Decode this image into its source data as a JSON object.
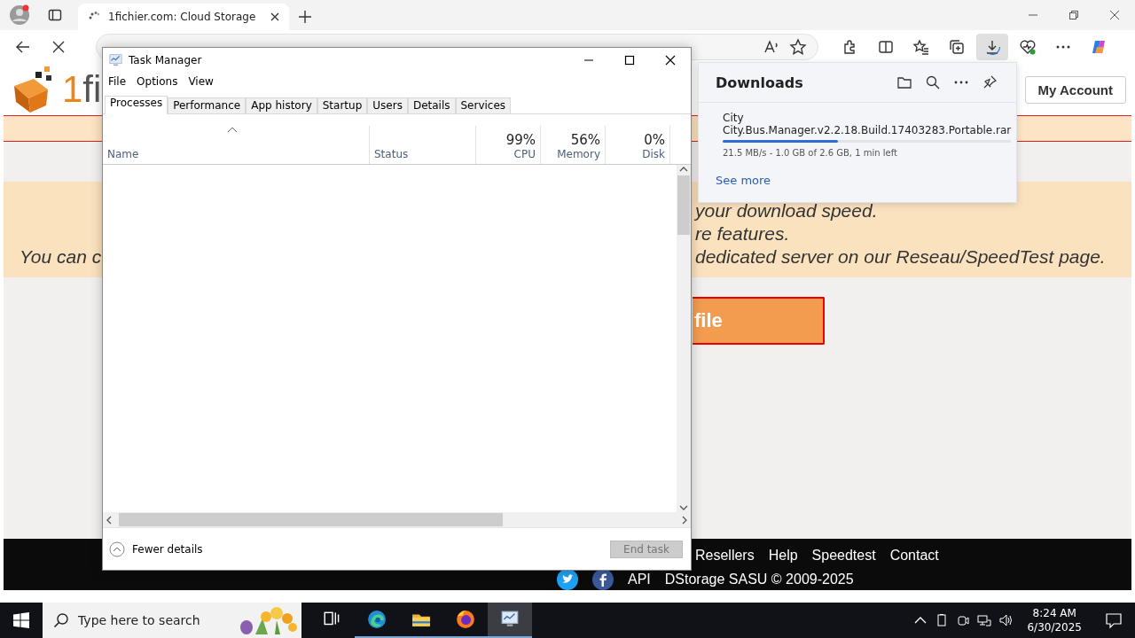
{
  "browser": {
    "tabs": [
      {
        "title": "1fichier.com: Cloud Storage",
        "selected": true,
        "loading": true
      }
    ],
    "toolbar": {
      "loading": true,
      "downloads_open": true
    }
  },
  "site": {
    "logo": {
      "accent": "1",
      "rest": "fi"
    },
    "account_button": "My Account",
    "notice_lines": [
      {
        "right": "your download speed."
      },
      {
        "right": "re features."
      },
      {
        "left": "You can c",
        "right": "dedicated server on our Reseau/SpeedTest page."
      }
    ],
    "download_button": "file",
    "footer": {
      "links": [
        "Resellers",
        "Help",
        "Speedtest",
        "Contact"
      ],
      "api": "API",
      "copyright": "DStorage SASU © 2009-2025"
    }
  },
  "task_manager": {
    "title": "Task Manager",
    "menu": [
      "File",
      "Options",
      "View"
    ],
    "tabs": [
      {
        "label": "Processes",
        "selected": true
      },
      {
        "label": "Performance",
        "selected": false
      },
      {
        "label": "App history",
        "selected": false
      },
      {
        "label": "Startup",
        "selected": false
      },
      {
        "label": "Users",
        "selected": false
      },
      {
        "label": "Details",
        "selected": false
      },
      {
        "label": "Services",
        "selected": false
      }
    ],
    "columns": [
      {
        "label": "Name",
        "kind": "text"
      },
      {
        "label": "Status",
        "kind": "text"
      },
      {
        "label": "CPU",
        "reading": "99%",
        "kind": "metric"
      },
      {
        "label": "Memory",
        "reading": "56%",
        "kind": "metric"
      },
      {
        "label": "Disk",
        "reading": "0%",
        "kind": "metric"
      }
    ],
    "fewer_details": "Fewer details",
    "end_task": {
      "label": "End task",
      "disabled": true
    }
  },
  "downloads": {
    "title": "Downloads",
    "items": [
      {
        "name": "City",
        "file": "City.Bus.Manager.v2.2.18.Build.17403283.Portable.rar",
        "level": 0.4,
        "status": "21.5 MB/s - 1.0 GB of 2.6 GB, 1 min left"
      }
    ],
    "see_more": "See more"
  },
  "taskbar": {
    "search_placeholder": "Type here to search",
    "apps": [
      {
        "kind": "task-view",
        "running": false,
        "selected": false
      },
      {
        "kind": "edge",
        "running": true,
        "selected": false
      },
      {
        "kind": "explorer",
        "running": true,
        "selected": false
      },
      {
        "kind": "firefox",
        "running": true,
        "selected": false
      },
      {
        "kind": "task-manager",
        "running": true,
        "selected": true
      }
    ],
    "time": "8:24 AM",
    "date": "6/30/2025"
  }
}
